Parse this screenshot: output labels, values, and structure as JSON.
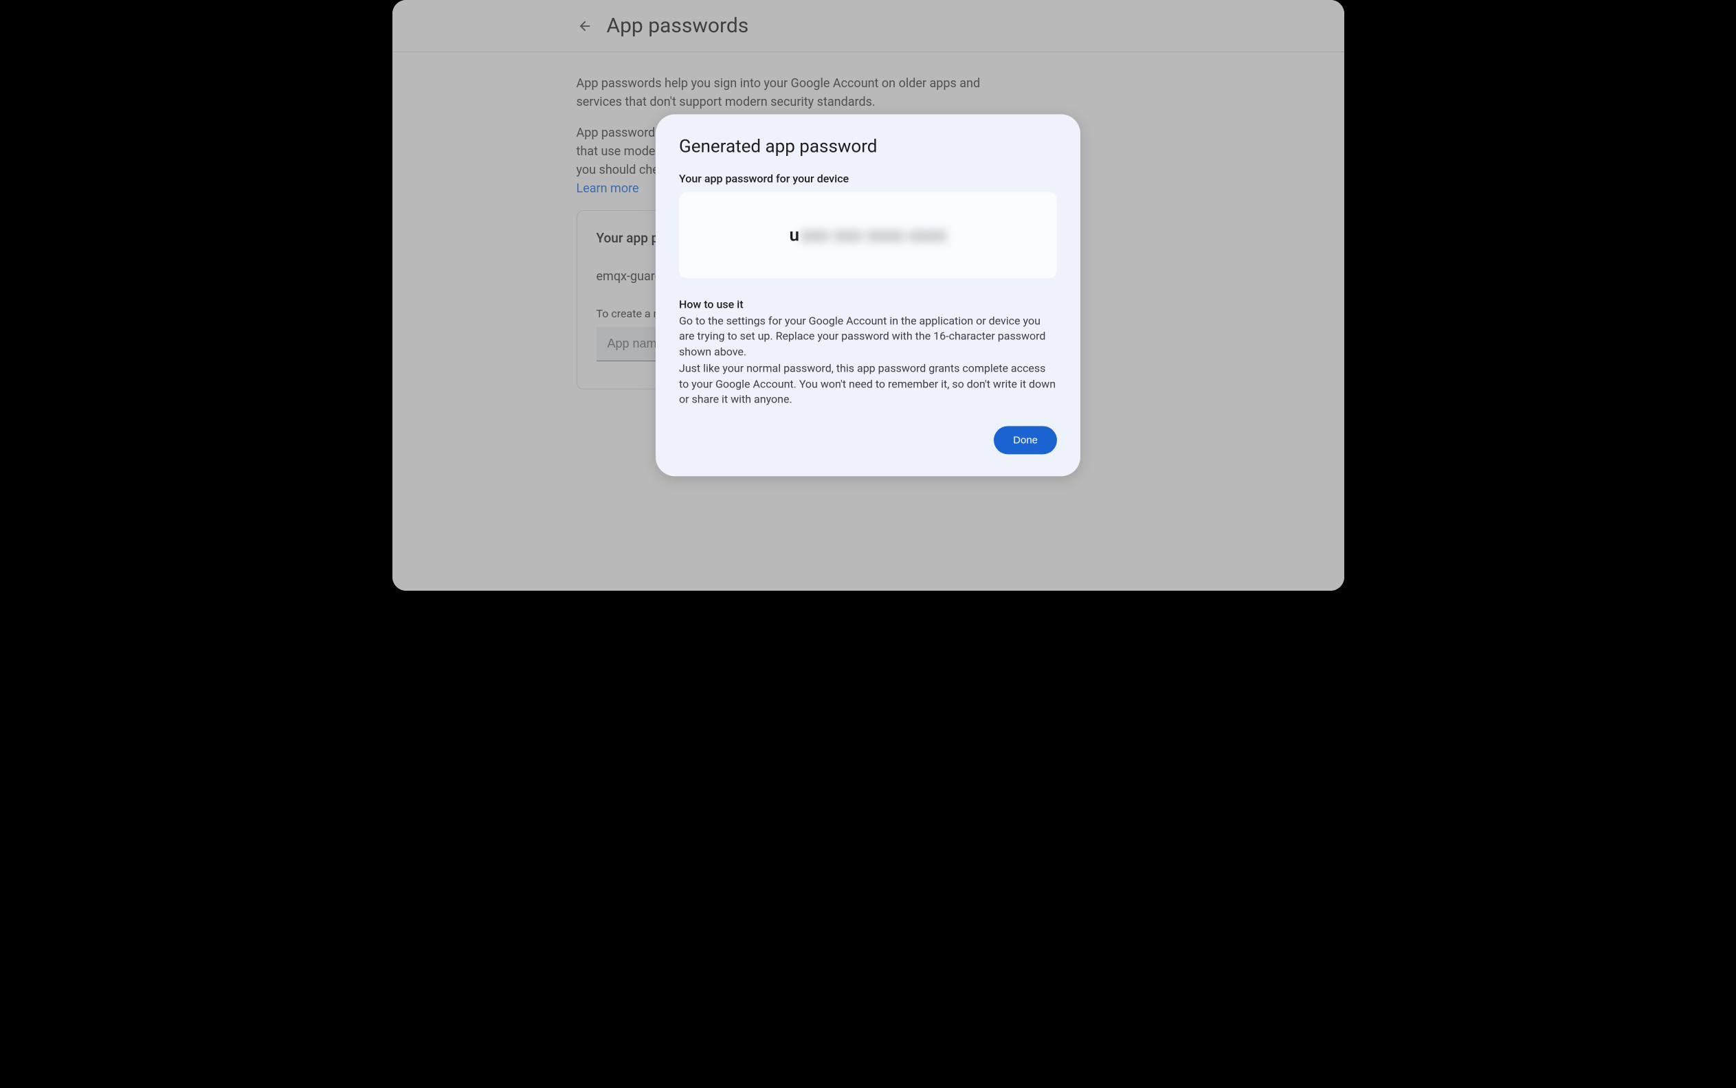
{
  "header": {
    "title": "App passwords"
  },
  "content": {
    "description1": "App passwords help you sign into your Google Account on older apps and services that don't support modern security standards.",
    "description2": "App passwords are less secure than using up-to-date apps and services that use modern security standards. Before you create an app password, you should check to",
    "learn_more": "Learn more"
  },
  "card": {
    "heading": "Your app passwords",
    "app_entry": "emqx-guard-pro",
    "create_hint": "To create a new app specific password, type a name for it below...",
    "input_placeholder": "App name"
  },
  "modal": {
    "title": "Generated app password",
    "subtitle": "Your app password for your device",
    "password_visible": "u",
    "password_blurred": "xxx xxx xxxx xxxx",
    "howto_heading": "How to use it",
    "howto_p1": "Go to the settings for your Google Account in the application or device you are trying to set up. Replace your password with the 16-character password shown above.",
    "howto_p2": "Just like your normal password, this app password grants complete access to your Google Account. You won't need to remember it, so don't write it down or share it with anyone.",
    "done_label": "Done"
  }
}
